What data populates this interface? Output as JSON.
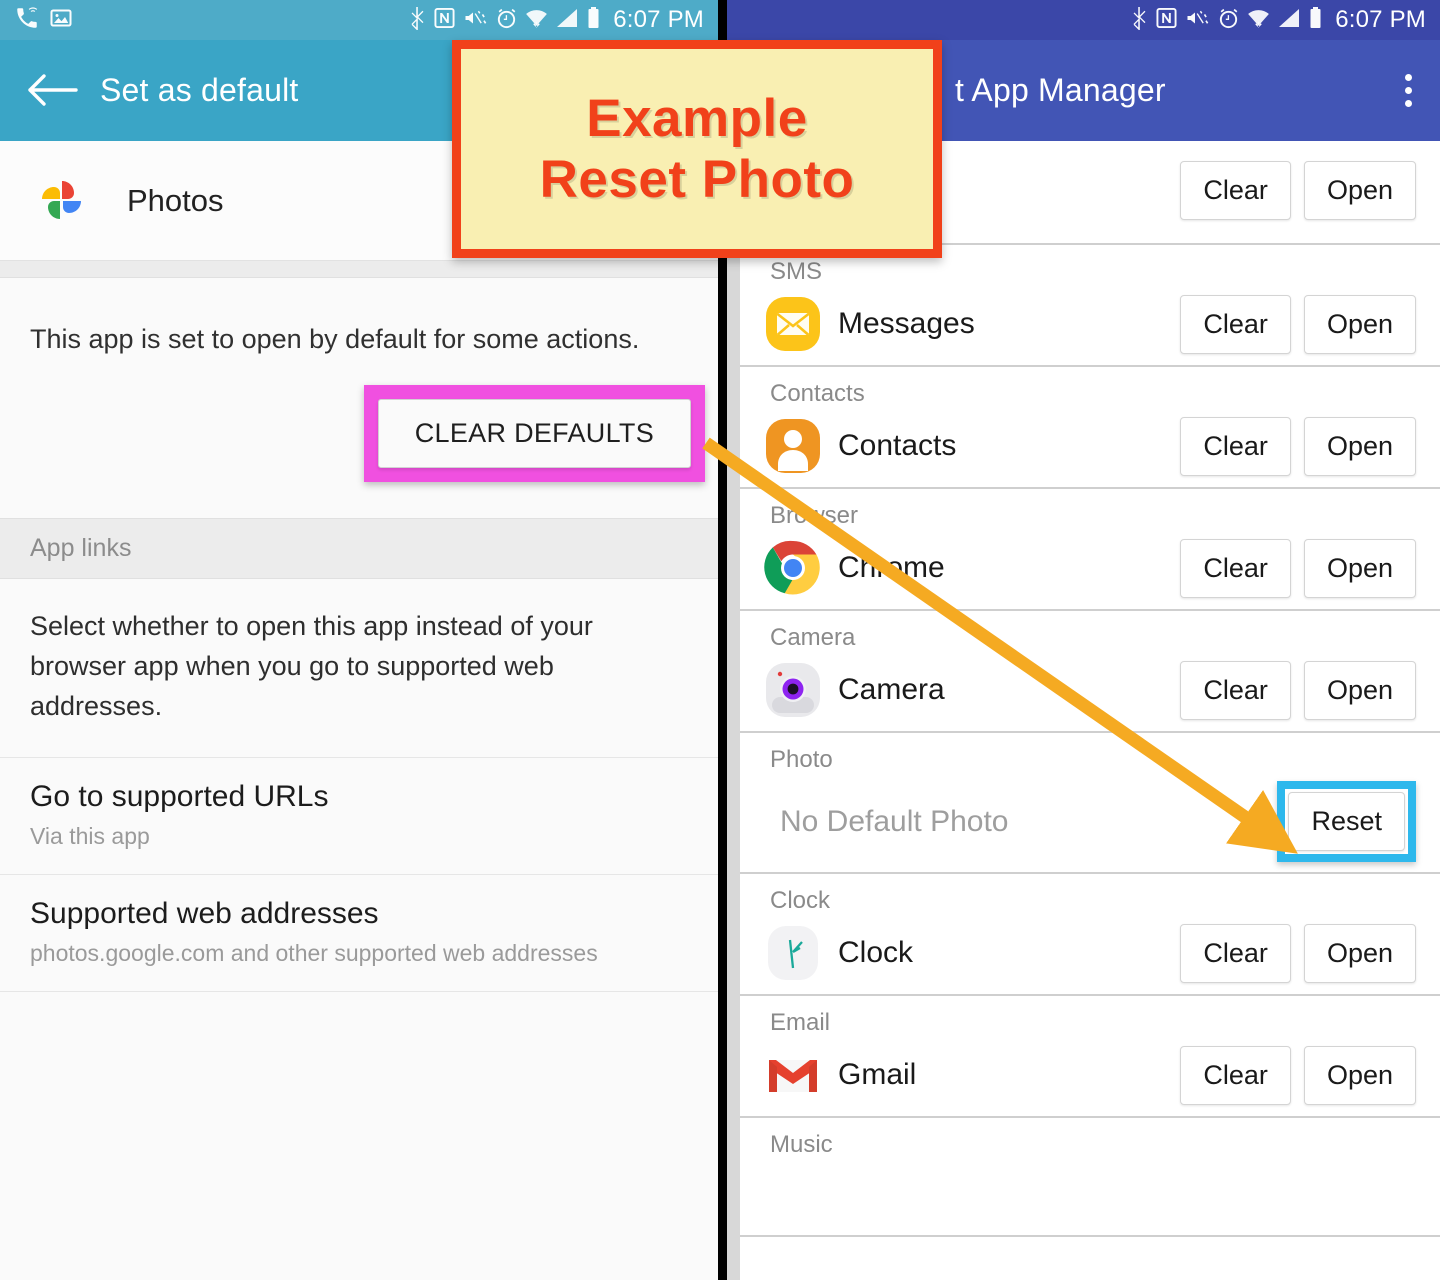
{
  "left_phone": {
    "status_bar": {
      "time": "6:07 PM",
      "left_icons": [
        "wifi-calling-icon",
        "screenshot-image-icon"
      ],
      "right_icons": [
        "bluetooth-icon",
        "nfc-icon",
        "vibrate-mute-icon",
        "alarm-icon",
        "wifi-icon",
        "cellular-signal-icon",
        "battery-icon"
      ]
    },
    "appbar": {
      "title": "Set as default",
      "back_icon": "back-arrow-icon"
    },
    "app": {
      "name": "Photos",
      "icon": "google-photos-icon"
    },
    "default_note": "This app is set to open by default for some actions.",
    "clear_defaults_label": "CLEAR DEFAULTS",
    "app_links_header": "App links",
    "app_links_desc": "Select whether to open this app instead of your browser app when you go to supported web addresses.",
    "rows": [
      {
        "title": "Go to supported URLs",
        "sub": "Via this app"
      },
      {
        "title": "Supported web addresses",
        "sub": "photos.google.com and other supported web addresses"
      }
    ]
  },
  "right_phone": {
    "status_bar": {
      "time": "6:07 PM",
      "right_icons": [
        "bluetooth-icon",
        "nfc-icon",
        "vibrate-mute-icon",
        "alarm-icon",
        "wifi-icon",
        "cellular-signal-icon",
        "battery-icon"
      ]
    },
    "appbar": {
      "title": "t App Manager",
      "menu_icon": "overflow-menu-icon"
    },
    "button_labels": {
      "clear": "Clear",
      "open": "Open",
      "reset": "Reset"
    },
    "items": [
      {
        "category": "",
        "app": "",
        "icon": "",
        "buttons": [
          "Clear",
          "Open"
        ],
        "partial": true
      },
      {
        "category": "SMS",
        "app": "Messages",
        "icon": "messages-icon",
        "buttons": [
          "Clear",
          "Open"
        ]
      },
      {
        "category": "Contacts",
        "app": "Contacts",
        "icon": "contacts-icon",
        "buttons": [
          "Clear",
          "Open"
        ]
      },
      {
        "category": "Browser",
        "app": "Chrome",
        "icon": "chrome-icon",
        "buttons": [
          "Clear",
          "Open"
        ]
      },
      {
        "category": "Camera",
        "app": "Camera",
        "icon": "camera-icon",
        "buttons": [
          "Clear",
          "Open"
        ]
      },
      {
        "category": "Photo",
        "app": "No Default Photo",
        "icon": "",
        "buttons": [
          "Reset"
        ],
        "muted": true,
        "highlight": true
      },
      {
        "category": "Clock",
        "app": "Clock",
        "icon": "clock-icon",
        "buttons": [
          "Clear",
          "Open"
        ]
      },
      {
        "category": "Email",
        "app": "Gmail",
        "icon": "gmail-icon",
        "buttons": [
          "Clear",
          "Open"
        ]
      },
      {
        "category": "Music",
        "app": "",
        "icon": "",
        "buttons": []
      }
    ]
  },
  "annotations": {
    "callout_line1": "Example",
    "callout_line2": "Reset Photo",
    "callout_bg": "#f9efb2",
    "callout_border": "#f1411a",
    "callout_text_color": "#f1411a",
    "clear_defaults_highlight_color": "#f050e0",
    "reset_highlight_color": "#2eb8ec",
    "arrow_color": "#f5aa22",
    "arrow_name": "orange-pointer-arrow"
  }
}
